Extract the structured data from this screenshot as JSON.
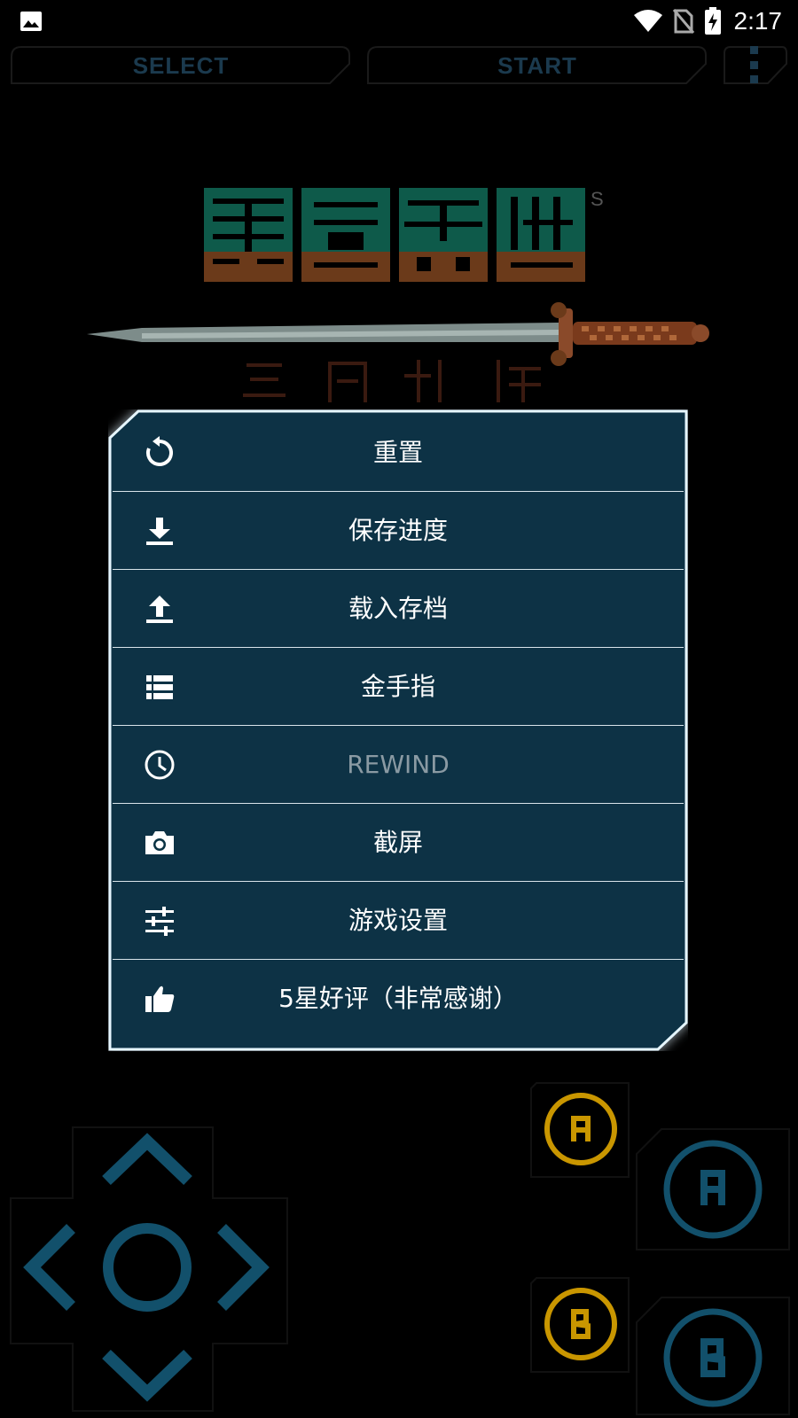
{
  "status_bar": {
    "time": "2:17",
    "icons": [
      "image-icon",
      "wifi-icon",
      "no-sim-icon",
      "battery-charging-icon"
    ]
  },
  "top_controls": {
    "select_label": "SELECT",
    "start_label": "START",
    "more_icon": "more-vert-icon"
  },
  "menu": {
    "items": [
      {
        "label": "重置",
        "icon": "reset-icon",
        "enabled": true
      },
      {
        "label": "保存进度",
        "icon": "download-icon",
        "enabled": true
      },
      {
        "label": "载入存档",
        "icon": "upload-icon",
        "enabled": true
      },
      {
        "label": "金手指",
        "icon": "list-icon",
        "enabled": true
      },
      {
        "label": "REWIND",
        "icon": "clock-icon",
        "enabled": false
      },
      {
        "label": "截屏",
        "icon": "camera-icon",
        "enabled": true
      },
      {
        "label": "游戏设置",
        "icon": "sliders-icon",
        "enabled": true
      },
      {
        "label": "5星好评（非常感谢）",
        "icon": "thumbs-up-icon",
        "enabled": true
      }
    ]
  },
  "colors": {
    "menu_bg": "#0a3344",
    "menu_border": "#e6f6ff",
    "control_blue": "#12506b",
    "control_gold": "#c99600",
    "button_text_dark": "#1b3a4e"
  }
}
